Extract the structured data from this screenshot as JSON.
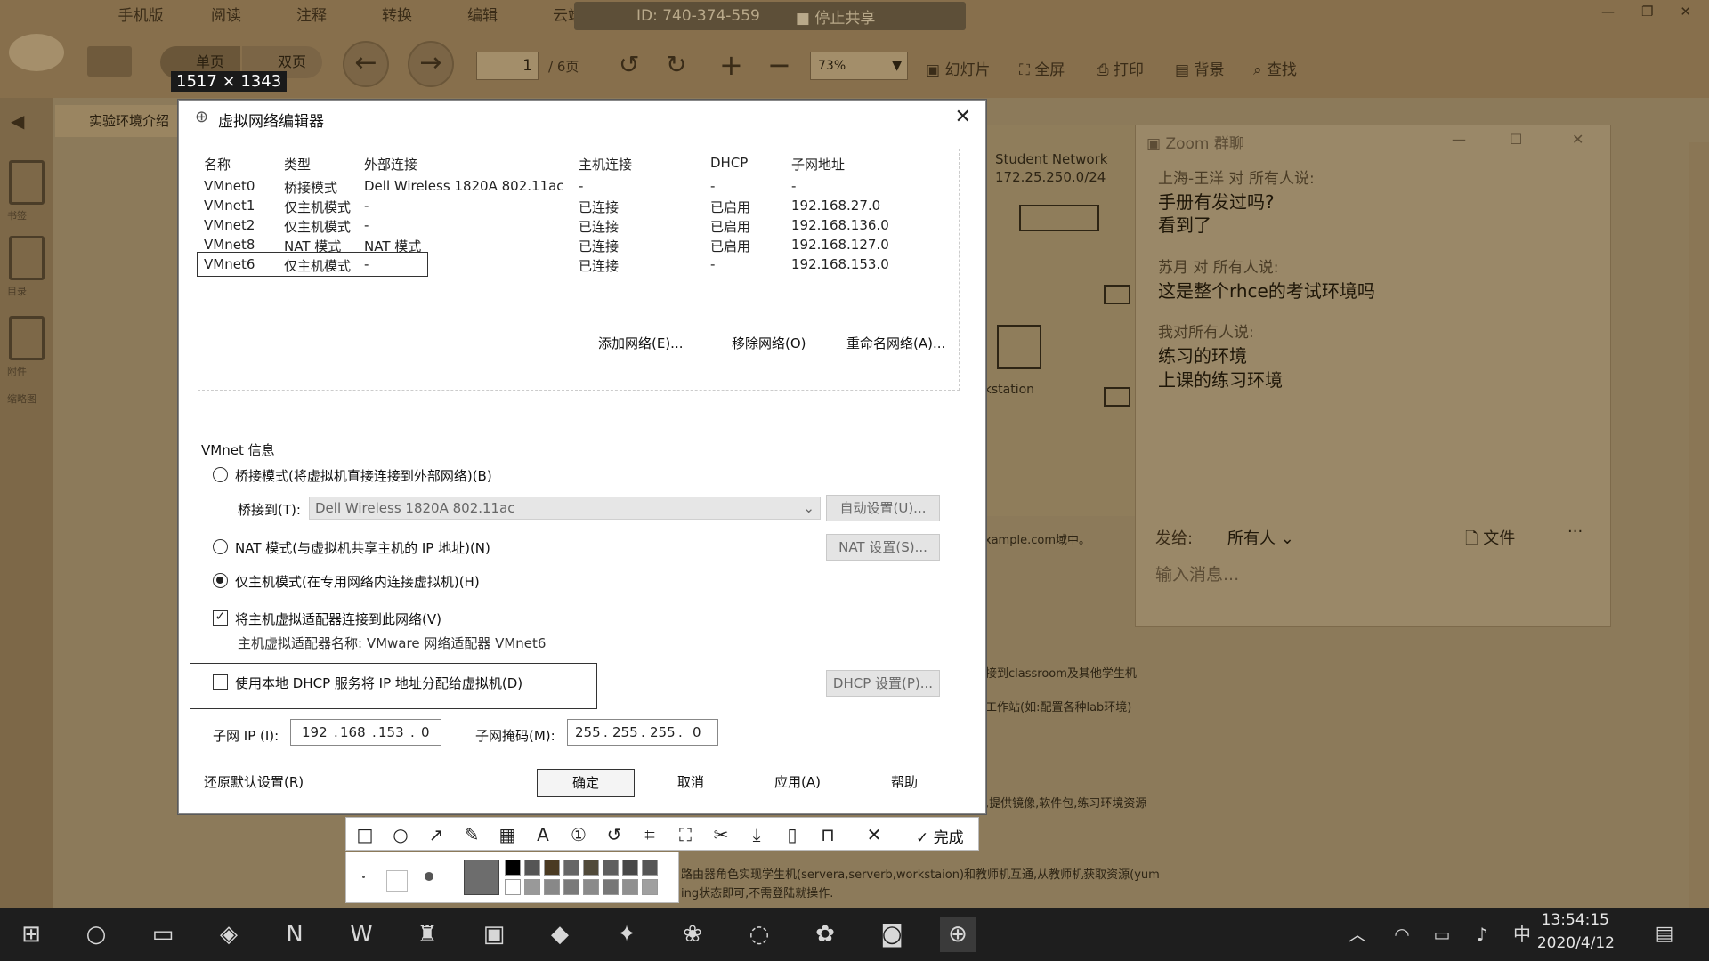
{
  "reader": {
    "menu": [
      "手机版",
      "阅读",
      "注释",
      "转换",
      "编辑",
      "云端"
    ],
    "share_id": "ID: 740-374-559",
    "stop_share": "停止共享",
    "toolbar": {
      "single_page": "单页",
      "double_page": "双页",
      "page_current": "1",
      "page_total": "/ 6页",
      "zoom": "73%",
      "slideshow": "幻灯片",
      "fullscreen": "全屏",
      "print": "打印",
      "background": "背景",
      "search": "查找"
    },
    "dims_badge": "1517 × 1343",
    "doc_tab": "实验环境介绍",
    "side_labels": [
      "书签",
      "目录",
      "附件",
      "缩略图"
    ],
    "page_lines": [
      "Student Network",
      "172.25.250.0/24",
      "rkstation",
      ".example.com域中。",
      "连接到classroom及其他学生机",
      "理工作站(如:配置各种lab环境)",
      "行,提供镜像,软件包,练习环境资源",
      "路由器角色实现学生机(servera,serverb,workstaion)和教师机互通,从教师机获取资源(yum",
      "ing状态即可,不需登陆就操作."
    ]
  },
  "zoom_chat": {
    "title": "Zoom 群聊",
    "messages": [
      {
        "from": "上海-王洋 对 所有人说:",
        "lines": [
          "手册有发过吗?",
          "看到了"
        ]
      },
      {
        "from": "苏月 对 所有人说:",
        "lines": [
          "这是整个rhce的考试环境吗"
        ]
      },
      {
        "from": "我对所有人说:",
        "lines": [
          "练习的环境",
          "上课的练习环境"
        ]
      }
    ],
    "send_to_label": "发给:",
    "recipient": "所有人",
    "file_label": "文件",
    "more": "···",
    "input_placeholder": "输入消息..."
  },
  "dialog": {
    "title": "虚拟网络编辑器",
    "columns": [
      "名称",
      "类型",
      "外部连接",
      "主机连接",
      "DHCP",
      "子网地址"
    ],
    "rows": [
      [
        "VMnet0",
        "桥接模式",
        "Dell Wireless 1820A 802.11ac",
        "-",
        "-",
        "-"
      ],
      [
        "VMnet1",
        "仅主机模式",
        "-",
        "已连接",
        "已启用",
        "192.168.27.0"
      ],
      [
        "VMnet2",
        "仅主机模式",
        "-",
        "已连接",
        "已启用",
        "192.168.136.0"
      ],
      [
        "VMnet8",
        "NAT 模式",
        "NAT 模式",
        "已连接",
        "已启用",
        "192.168.127.0"
      ],
      [
        "VMnet6",
        "仅主机模式",
        "-",
        "已连接",
        "-",
        "192.168.153.0"
      ]
    ],
    "selected_row": "VMnet6",
    "add_network": "添加网络(E)...",
    "remove_network": "移除网络(O)",
    "rename_network": "重命名网络(A)...",
    "vmnet_info": "VMnet 信息",
    "bridge_mode": "桥接模式(将虚拟机直接连接到外部网络)(B)",
    "bridge_to": "桥接到(T):",
    "bridge_adapter": "Dell Wireless 1820A 802.11ac",
    "auto_settings": "自动设置(U)...",
    "nat_mode": "NAT 模式(与虚拟机共享主机的 IP 地址)(N)",
    "nat_settings": "NAT 设置(S)...",
    "host_only": "仅主机模式(在专用网络内连接虚拟机)(H)",
    "selected_mode": "host_only",
    "connect_adapter": "将主机虚拟适配器连接到此网络(V)",
    "connect_adapter_checked": true,
    "adapter_name": "主机虚拟适配器名称: VMware 网络适配器 VMnet6",
    "use_dhcp": "使用本地 DHCP 服务将 IP 地址分配给虚拟机(D)",
    "use_dhcp_checked": false,
    "dhcp_settings": "DHCP 设置(P)...",
    "subnet_ip_label": "子网 IP (I):",
    "subnet_ip": [
      "192",
      "168",
      "153",
      "0"
    ],
    "subnet_mask_label": "子网掩码(M):",
    "subnet_mask": [
      "255",
      "255",
      "255",
      "0"
    ],
    "restore_defaults": "还原默认设置(R)",
    "ok": "确定",
    "cancel": "取消",
    "apply": "应用(A)",
    "help": "帮助"
  },
  "annotation": {
    "done": "完成"
  },
  "taskbar": {
    "time": "13:54:15",
    "date": "2020/4/12",
    "ime": "中"
  }
}
